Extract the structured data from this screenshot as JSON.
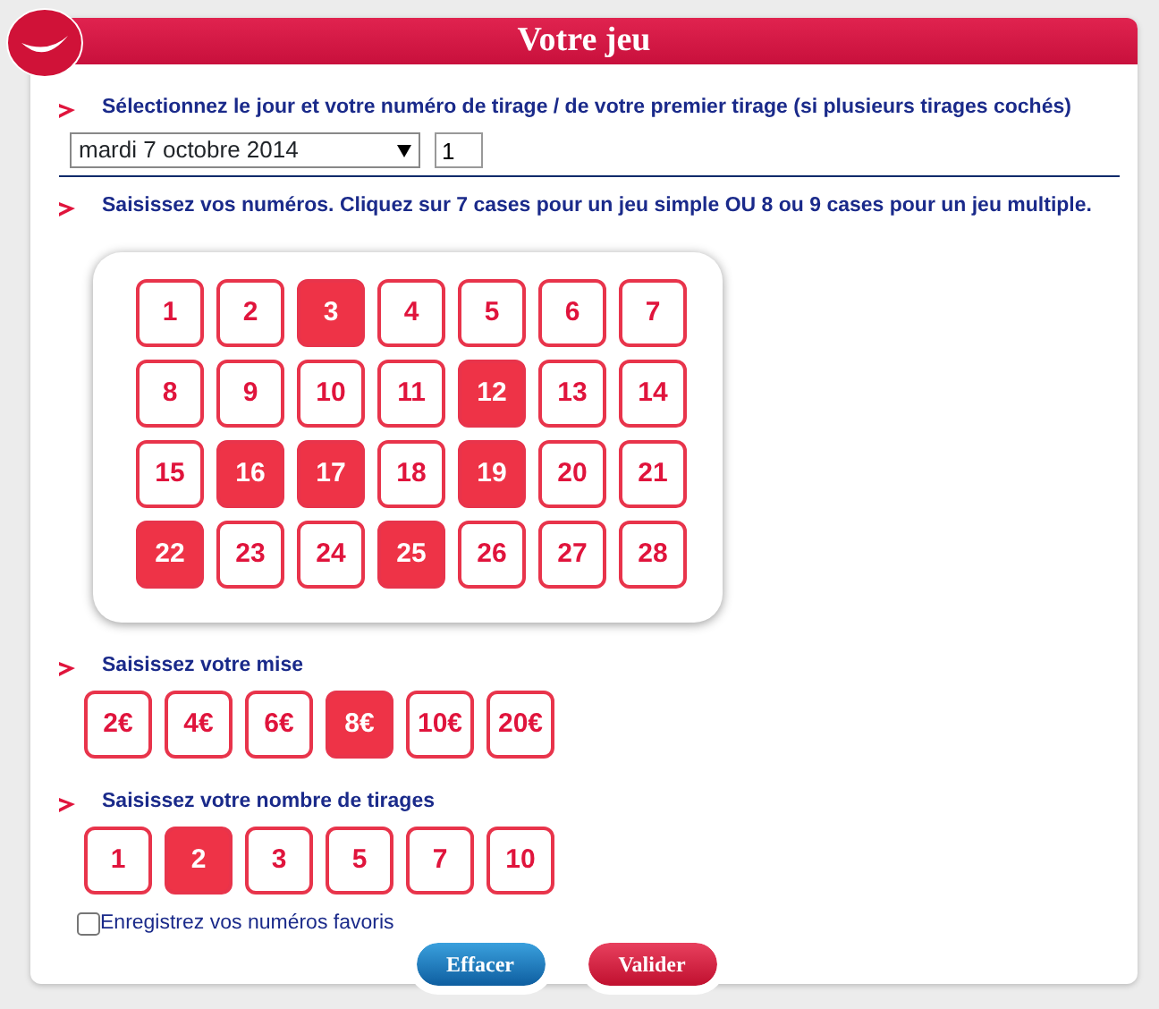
{
  "title": "Votre jeu",
  "draw_section": {
    "label": "Sélectionnez le jour et votre numéro de tirage / de votre premier tirage (si plusieurs tirages cochés)",
    "date": "mardi 7 octobre 2014",
    "draw_number": "1"
  },
  "numbers_section": {
    "label": "Saisissez vos numéros. Cliquez sur 7 cases pour un jeu simple OU 8 ou 9 cases pour un jeu multiple.",
    "numbers": [
      {
        "label": "1",
        "selected": false
      },
      {
        "label": "2",
        "selected": false
      },
      {
        "label": "3",
        "selected": true
      },
      {
        "label": "4",
        "selected": false
      },
      {
        "label": "5",
        "selected": false
      },
      {
        "label": "6",
        "selected": false
      },
      {
        "label": "7",
        "selected": false
      },
      {
        "label": "8",
        "selected": false
      },
      {
        "label": "9",
        "selected": false
      },
      {
        "label": "10",
        "selected": false
      },
      {
        "label": "11",
        "selected": false
      },
      {
        "label": "12",
        "selected": true
      },
      {
        "label": "13",
        "selected": false
      },
      {
        "label": "14",
        "selected": false
      },
      {
        "label": "15",
        "selected": false
      },
      {
        "label": "16",
        "selected": true
      },
      {
        "label": "17",
        "selected": true
      },
      {
        "label": "18",
        "selected": false
      },
      {
        "label": "19",
        "selected": true
      },
      {
        "label": "20",
        "selected": false
      },
      {
        "label": "21",
        "selected": false
      },
      {
        "label": "22",
        "selected": true
      },
      {
        "label": "23",
        "selected": false
      },
      {
        "label": "24",
        "selected": false
      },
      {
        "label": "25",
        "selected": true
      },
      {
        "label": "26",
        "selected": false
      },
      {
        "label": "27",
        "selected": false
      },
      {
        "label": "28",
        "selected": false
      }
    ]
  },
  "stake_section": {
    "label": "Saisissez votre mise",
    "options": [
      {
        "label": "2€",
        "selected": false
      },
      {
        "label": "4€",
        "selected": false
      },
      {
        "label": "6€",
        "selected": false
      },
      {
        "label": "8€",
        "selected": true
      },
      {
        "label": "10€",
        "selected": false
      },
      {
        "label": "20€",
        "selected": false
      }
    ]
  },
  "draws_section": {
    "label": "Saisissez votre nombre de tirages",
    "options": [
      {
        "label": "1",
        "selected": false
      },
      {
        "label": "2",
        "selected": true
      },
      {
        "label": "3",
        "selected": false
      },
      {
        "label": "5",
        "selected": false
      },
      {
        "label": "7",
        "selected": false
      },
      {
        "label": "10",
        "selected": false
      }
    ]
  },
  "favorites": {
    "label": "Enregistrez vos numéros favoris",
    "checked": false
  },
  "buttons": [
    {
      "label": "Effacer",
      "kind": "secondary"
    },
    {
      "label": "Valider",
      "kind": "primary"
    }
  ]
}
